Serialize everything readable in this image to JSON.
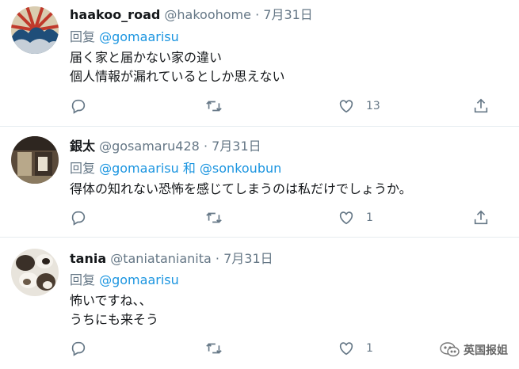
{
  "tweets": [
    {
      "name": "haakoo_road",
      "handle": "@hakoohome",
      "dot": "·",
      "date": "7月31日",
      "reply_prefix": "回复",
      "mentions": "@gomaarisu",
      "body_lines": [
        "届く家と届かない家の違い",
        "個人情報が漏れているとしか思えない"
      ],
      "like_count": "13"
    },
    {
      "name": "銀太",
      "handle": "@gosamaru428",
      "dot": "·",
      "date": "7月31日",
      "reply_prefix": "回复",
      "mentions": "@gomaarisu 和 @sonkoubun",
      "body_lines": [
        "得体の知れない恐怖を感じてしまうのは私だけでしょうか。"
      ],
      "like_count": "1"
    },
    {
      "name": "tania",
      "handle": "@taniatanianita",
      "dot": "·",
      "date": "7月31日",
      "reply_prefix": "回复",
      "mentions": "@gomaarisu",
      "body_lines": [
        "怖いですね、、",
        "うちにも来そう"
      ],
      "like_count": "1"
    }
  ],
  "watermark": {
    "text": "英国报姐",
    "icon": "wechat-icon"
  },
  "icons": {
    "reply": "reply-icon",
    "retweet": "retweet-icon",
    "like": "heart-icon",
    "share": "share-icon"
  },
  "colors": {
    "link": "#1b95e0",
    "muted": "#657786",
    "text": "#14171a",
    "divider": "#e6ecf0"
  }
}
